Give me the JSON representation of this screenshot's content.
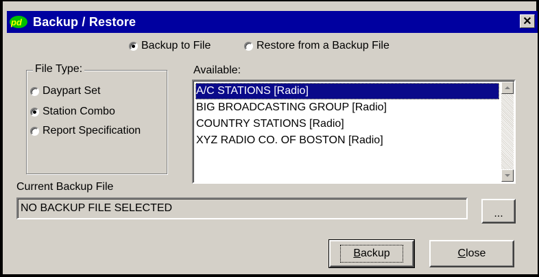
{
  "window": {
    "title": "Backup / Restore",
    "close_glyph": "✕",
    "icon": "app-logo-icon"
  },
  "mode": {
    "options": [
      {
        "label": "Backup to File",
        "selected": true
      },
      {
        "label": "Restore from a Backup File",
        "selected": false
      }
    ]
  },
  "file_type": {
    "label": "File Type:",
    "options": [
      {
        "label": "Daypart Set",
        "selected": false
      },
      {
        "label": "Station Combo",
        "selected": true
      },
      {
        "label": "Report Specification",
        "selected": false
      }
    ]
  },
  "available": {
    "label": "Available:",
    "items": [
      {
        "text": "A/C STATIONS  [Radio]",
        "selected": true
      },
      {
        "text": "BIG BROADCASTING GROUP  [Radio]",
        "selected": false
      },
      {
        "text": "COUNTRY STATIONS  [Radio]",
        "selected": false
      },
      {
        "text": "XYZ RADIO CO. OF BOSTON  [Radio]",
        "selected": false
      }
    ]
  },
  "backup_file": {
    "label": "Current Backup File",
    "value": "NO BACKUP FILE SELECTED",
    "browse_label": "..."
  },
  "buttons": {
    "backup_hotkey": "B",
    "backup_rest": "ackup",
    "close_hotkey": "C",
    "close_rest": "lose"
  },
  "colors": {
    "titlebar": "#0000a0",
    "face": "#d4d0c8",
    "selection": "#0a0a8a"
  }
}
